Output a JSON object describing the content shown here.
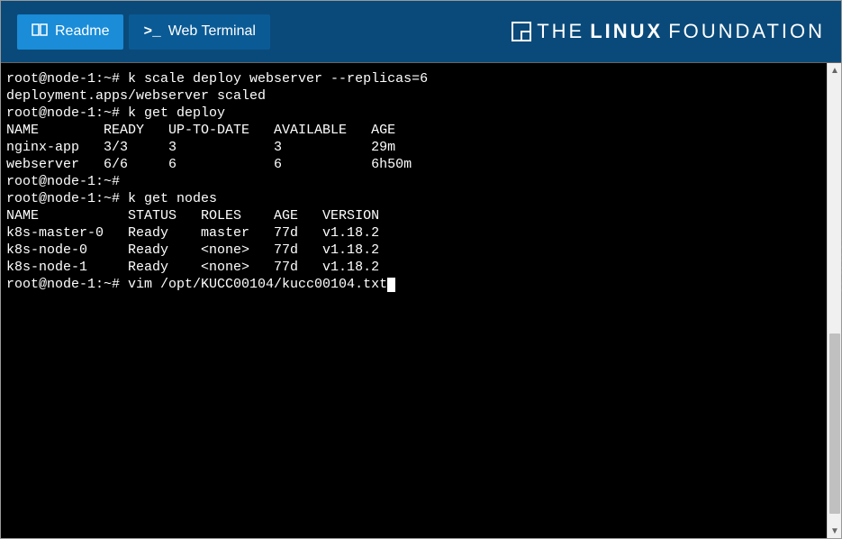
{
  "header": {
    "tabs": {
      "readme_label": "Readme",
      "terminal_label": "Web Terminal"
    },
    "logo": {
      "the": "THE",
      "linux": "LINUX",
      "foundation": "FOUNDATION"
    }
  },
  "terminal": {
    "lines": [
      "root@node-1:~# k scale deploy webserver --replicas=6",
      "deployment.apps/webserver scaled",
      "root@node-1:~# k get deploy",
      "NAME        READY   UP-TO-DATE   AVAILABLE   AGE",
      "nginx-app   3/3     3            3           29m",
      "webserver   6/6     6            6           6h50m",
      "root@node-1:~#",
      "root@node-1:~# k get nodes",
      "NAME           STATUS   ROLES    AGE   VERSION",
      "k8s-master-0   Ready    master   77d   v1.18.2",
      "k8s-node-0     Ready    <none>   77d   v1.18.2",
      "k8s-node-1     Ready    <none>   77d   v1.18.2"
    ],
    "current_prompt": "root@node-1:~# vim /opt/KUCC00104/kucc00104.txt"
  },
  "deploy_table": {
    "headers": [
      "NAME",
      "READY",
      "UP-TO-DATE",
      "AVAILABLE",
      "AGE"
    ],
    "rows": [
      {
        "NAME": "nginx-app",
        "READY": "3/3",
        "UP-TO-DATE": "3",
        "AVAILABLE": "3",
        "AGE": "29m"
      },
      {
        "NAME": "webserver",
        "READY": "6/6",
        "UP-TO-DATE": "6",
        "AVAILABLE": "6",
        "AGE": "6h50m"
      }
    ]
  },
  "nodes_table": {
    "headers": [
      "NAME",
      "STATUS",
      "ROLES",
      "AGE",
      "VERSION"
    ],
    "rows": [
      {
        "NAME": "k8s-master-0",
        "STATUS": "Ready",
        "ROLES": "master",
        "AGE": "77d",
        "VERSION": "v1.18.2"
      },
      {
        "NAME": "k8s-node-0",
        "STATUS": "Ready",
        "ROLES": "<none>",
        "AGE": "77d",
        "VERSION": "v1.18.2"
      },
      {
        "NAME": "k8s-node-1",
        "STATUS": "Ready",
        "ROLES": "<none>",
        "AGE": "77d",
        "VERSION": "v1.18.2"
      }
    ]
  }
}
